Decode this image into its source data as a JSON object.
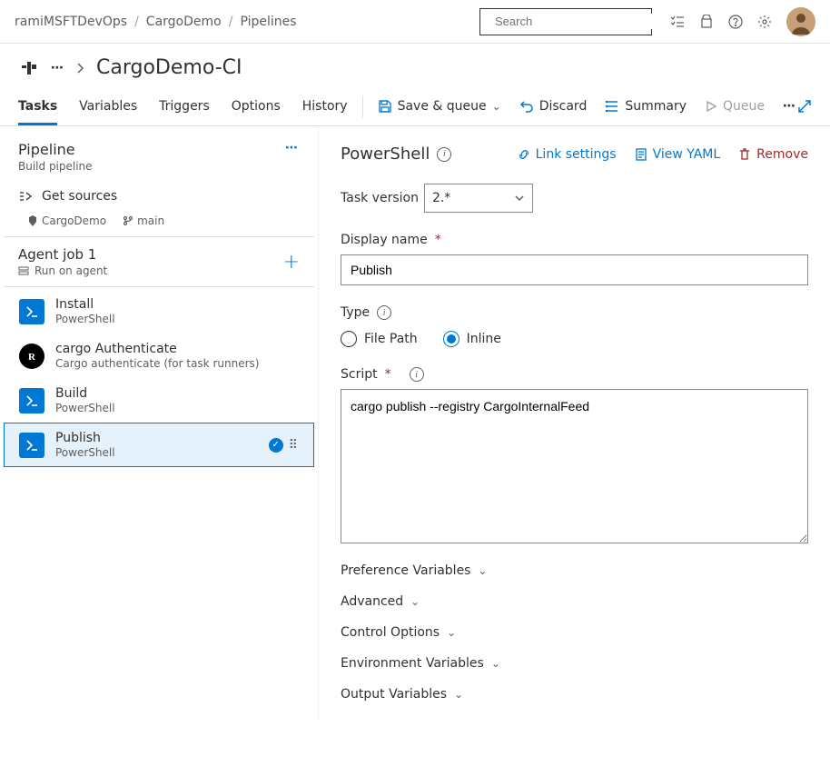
{
  "breadcrumbs": {
    "org": "ramiMSFTDevOps",
    "project": "CargoDemo",
    "section": "Pipelines"
  },
  "search": {
    "placeholder": "Search"
  },
  "page": {
    "title": "CargoDemo-CI"
  },
  "tabs": {
    "tasks": "Tasks",
    "variables": "Variables",
    "triggers": "Triggers",
    "options": "Options",
    "history": "History"
  },
  "cmds": {
    "save_queue": "Save & queue",
    "discard": "Discard",
    "summary": "Summary",
    "queue": "Queue"
  },
  "pipeline": {
    "name": "Pipeline",
    "sub": "Build pipeline",
    "get_sources": "Get sources",
    "repo": "CargoDemo",
    "branch": "main",
    "job_name": "Agent job 1",
    "job_sub": "Run on agent",
    "tasks": [
      {
        "name": "Install",
        "sub": "PowerShell",
        "iconType": "ps"
      },
      {
        "name": "cargo Authenticate",
        "sub": "Cargo authenticate (for task runners)",
        "iconType": "rust"
      },
      {
        "name": "Build",
        "sub": "PowerShell",
        "iconType": "ps"
      },
      {
        "name": "Publish",
        "sub": "PowerShell",
        "iconType": "ps"
      }
    ]
  },
  "panel": {
    "title": "PowerShell",
    "link_settings": "Link settings",
    "view_yaml": "View YAML",
    "remove": "Remove",
    "task_version_label": "Task version",
    "task_version_value": "2.*",
    "display_name_label": "Display name",
    "display_name_value": "Publish",
    "type_label": "Type",
    "type_file_path": "File Path",
    "type_inline": "Inline",
    "script_label": "Script",
    "script_value": "cargo publish --registry CargoInternalFeed",
    "sections": {
      "pref_vars": "Preference Variables",
      "advanced": "Advanced",
      "control_options": "Control Options",
      "env_vars": "Environment Variables",
      "output_vars": "Output Variables"
    }
  }
}
